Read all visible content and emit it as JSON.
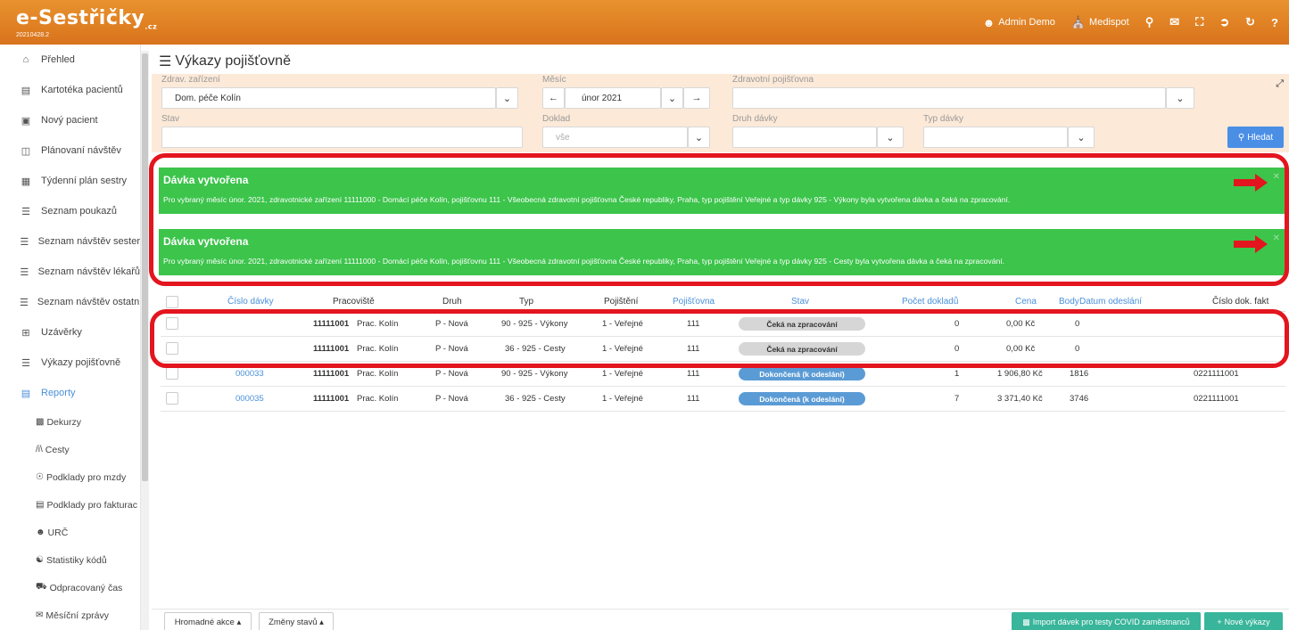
{
  "app": {
    "logo_text": "e-Sestřičky",
    "logo_suffix": ".cz",
    "version": "20210428.2"
  },
  "topnav": {
    "user_label": "Admin Demo",
    "org_label": "Medispot"
  },
  "sidebar": {
    "items": [
      {
        "label": "Přehled",
        "icon": "home-icon"
      },
      {
        "label": "Kartotéka pacientů",
        "icon": "card-icon"
      },
      {
        "label": "Nový pacient",
        "icon": "id-card-icon"
      },
      {
        "label": "Plánovaní návštěv",
        "icon": "map-icon"
      },
      {
        "label": "Týdenní plán sestry",
        "icon": "calendar-icon"
      },
      {
        "label": "Seznam poukazů",
        "icon": "list-icon"
      },
      {
        "label": "Seznam návštěv sester",
        "icon": "list-icon"
      },
      {
        "label": "Seznam návštěv lékařů",
        "icon": "list-icon"
      },
      {
        "label": "Seznam návštěv ostatní",
        "icon": "list-icon"
      },
      {
        "label": "Uzávěrky",
        "icon": "grid-icon"
      },
      {
        "label": "Výkazy pojišťovně",
        "icon": "list-icon"
      },
      {
        "label": "Reporty",
        "icon": "report-icon"
      }
    ],
    "subitems": [
      {
        "label": "Dekurzy",
        "icon": "clipboard-icon"
      },
      {
        "label": "Cesty",
        "icon": "road-icon"
      },
      {
        "label": "Podklady pro mzdy",
        "icon": "coin-icon"
      },
      {
        "label": "Podklady pro fakturac",
        "icon": "table-icon"
      },
      {
        "label": "URČ",
        "icon": "user-icon"
      },
      {
        "label": "Statistiky kódů",
        "icon": "stats-icon"
      },
      {
        "label": "Odpracovaný čas",
        "icon": "car-icon"
      },
      {
        "label": "Měsíční zprávy",
        "icon": "mail-icon"
      }
    ]
  },
  "page": {
    "title": "Výkazy pojišťovně"
  },
  "filters": {
    "zarizeni_label": "Zdrav. zařízení",
    "zarizeni_value": "Dom. péče Kolín",
    "mesic_label": "Měsíc",
    "mesic_value": "únor 2021",
    "pojistovna_label": "Zdravotní pojišťovna",
    "pojistovna_value": "",
    "stav_label": "Stav",
    "stav_value": "",
    "doklad_label": "Doklad",
    "doklad_value": "vše",
    "druh_label": "Druh dávky",
    "druh_value": "",
    "typ_label": "Typ dávky",
    "typ_value": "",
    "search_label": "Hledat"
  },
  "alerts": [
    {
      "title": "Dávka vytvořena",
      "text": "Pro vybraný měsíc únor. 2021, zdravotnické zařízení 11111000 - Domácí péče Kolín, pojišťovnu 111 - Všeobecná zdravotní pojišťovna České republiky, Praha, typ pojištění Veřejné a typ dávky 925 - Výkony byla vytvořena dávka a čeká na zpracování."
    },
    {
      "title": "Dávka vytvořena",
      "text": "Pro vybraný měsíc únor. 2021, zdravotnické zařízení 11111000 - Domácí péče Kolín, pojišťovnu 111 - Všeobecná zdravotní pojišťovna České republiky, Praha, typ pojištění Veřejné a typ dávky 925 - Cesty byla vytvořena dávka a čeká na zpracování."
    }
  ],
  "table": {
    "columns": [
      "Číslo dávky",
      "Pracoviště",
      "Druh",
      "Typ",
      "Pojištění",
      "Pojišťovna",
      "Stav",
      "Počet dokladů",
      "Cena",
      "Body",
      "Datum odeslání",
      "Číslo dok. fakt"
    ],
    "rows": [
      {
        "cislo": "",
        "kod": "11111001",
        "pracoviste": "Prac. Kolín",
        "druh": "P - Nová",
        "typ": "90 - 925 - Výkony",
        "pojisteni": "1 - Veřejné",
        "pojistovna": "111",
        "stav": "Čeká na zpracování",
        "stav_color": "#d6d6d6",
        "pocet": "0",
        "cena": "0,00 Kč",
        "body": "0",
        "datum": "",
        "faktura": ""
      },
      {
        "cislo": "",
        "kod": "11111001",
        "pracoviste": "Prac. Kolín",
        "druh": "P - Nová",
        "typ": "36 - 925 - Cesty",
        "pojisteni": "1 - Veřejné",
        "pojistovna": "111",
        "stav": "Čeká na zpracování",
        "stav_color": "#d6d6d6",
        "pocet": "0",
        "cena": "0,00 Kč",
        "body": "0",
        "datum": "",
        "faktura": ""
      },
      {
        "cislo": "000033",
        "kod": "11111001",
        "pracoviste": "Prac. Kolín",
        "druh": "P - Nová",
        "typ": "90 - 925 - Výkony",
        "pojisteni": "1 - Veřejné",
        "pojistovna": "111",
        "stav": "Dokončená (k odeslání)",
        "stav_color": "#5b9bd5",
        "pocet": "1",
        "cena": "1 906,80 Kč",
        "body": "1816",
        "datum": "",
        "faktura": "0221111001"
      },
      {
        "cislo": "000035",
        "kod": "11111001",
        "pracoviste": "Prac. Kolín",
        "druh": "P - Nová",
        "typ": "36 - 925 - Cesty",
        "pojisteni": "1 - Veřejné",
        "pojistovna": "111",
        "stav": "Dokončená (k odeslání)",
        "stav_color": "#5b9bd5",
        "pocet": "7",
        "cena": "3 371,40 Kč",
        "body": "3746",
        "datum": "",
        "faktura": "0221111001"
      }
    ]
  },
  "bottom": {
    "mass_actions": "Hromadné akce ▴",
    "state_changes": "Změny stavů ▴",
    "import_label": "Import dávek pro testy COVID zaměstnanců",
    "new_label": "Nové výkazy"
  },
  "colors": {
    "topbar": "#e08527",
    "alert_green": "#3cc44b",
    "highlight_red": "#e3151e",
    "link_blue": "#4a90d9",
    "button_green": "#38b59a"
  }
}
